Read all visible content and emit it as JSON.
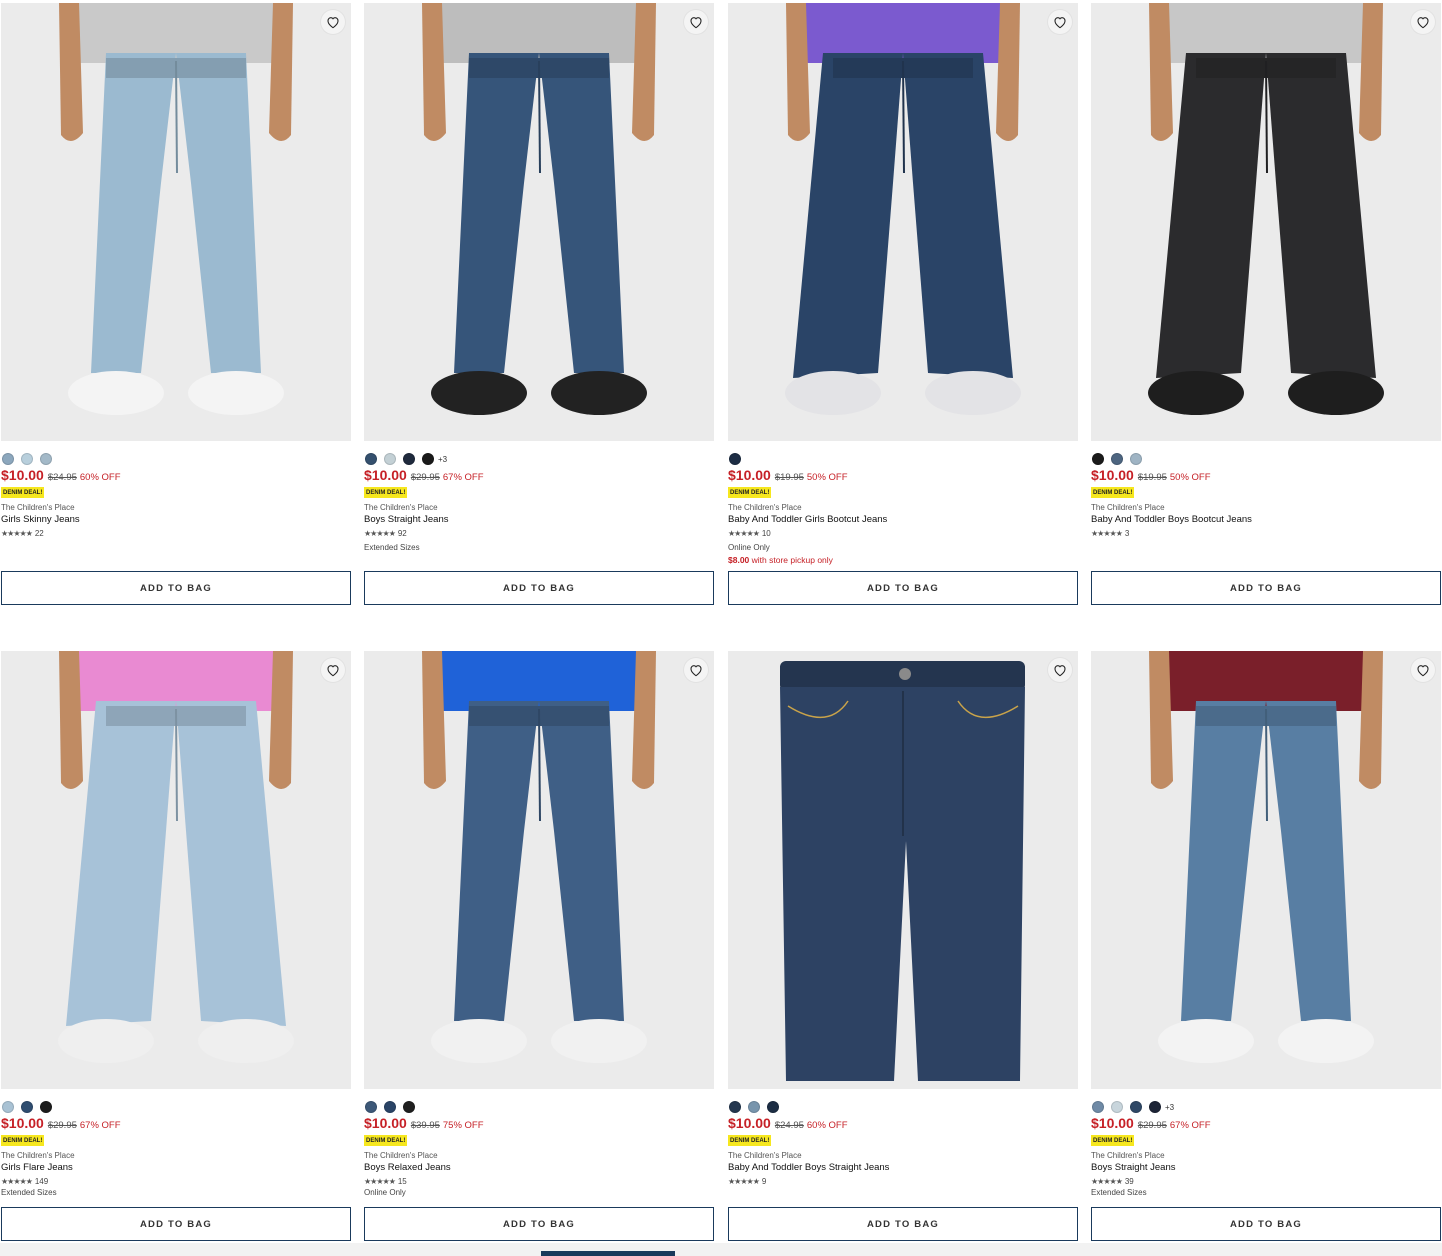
{
  "wishlist_icon": "heart-outline-icon",
  "add_to_bag_label": "ADD TO BAG",
  "colors": {
    "sale_red": "#c62127",
    "badge_yellow": "#f6e71e",
    "button_border": "#1a3a5c"
  },
  "products": [
    {
      "swatches": [
        "#8ca7bd",
        "#b8cfdc",
        "#a3b9c8"
      ],
      "more": "",
      "price": "$10.00",
      "was": "$24.95",
      "off": "60% OFF",
      "badge": "DENIM DEAL!",
      "brand": "The Children's Place",
      "name": "Girls Skinny Jeans",
      "stars": "★★★★★",
      "reviews": "22",
      "extra": "",
      "pickup_price": "",
      "pickup_text": "",
      "jean_color": "#9bbad0",
      "shirt_color": "#c9c9c9",
      "shoe_color": "#f4f4f4"
    },
    {
      "swatches": [
        "#34506e",
        "#c3d0d5",
        "#1f2a3d",
        "#1a1a1a"
      ],
      "more": "+3",
      "price": "$10.00",
      "was": "$29.95",
      "off": "67% OFF",
      "badge": "DENIM DEAL!",
      "brand": "The Children's Place",
      "name": "Boys Straight Jeans",
      "stars": "★★★★★",
      "reviews": "92",
      "extra": "Extended Sizes",
      "pickup_price": "",
      "pickup_text": "",
      "jean_color": "#36557a",
      "shirt_color": "#bdbdbd",
      "shoe_color": "#222222"
    },
    {
      "swatches": [
        "#1d2d44"
      ],
      "more": "",
      "price": "$10.00",
      "was": "$19.95",
      "off": "50% OFF",
      "badge": "DENIM DEAL!",
      "brand": "The Children's Place",
      "name": "Baby And Toddler Girls Bootcut Jeans",
      "stars": "★★★★★",
      "reviews": "10",
      "extra": "Online Only",
      "pickup_price": "$8.00",
      "pickup_text": "with store pickup only",
      "jean_color": "#2a4467",
      "shirt_color": "#7b5acf",
      "shoe_color": "#e3e3e6"
    },
    {
      "swatches": [
        "#1b1b1b",
        "#4d6580",
        "#9fb4c4"
      ],
      "more": "",
      "price": "$10.00",
      "was": "$19.95",
      "off": "50% OFF",
      "badge": "DENIM DEAL!",
      "brand": "The Children's Place",
      "name": "Baby And Toddler Boys Bootcut Jeans",
      "stars": "★★★★★",
      "reviews": "3",
      "extra": "",
      "pickup_price": "",
      "pickup_text": "",
      "jean_color": "#2b2b2d",
      "shirt_color": "#c7c7c7",
      "shoe_color": "#1e1e1e"
    },
    {
      "swatches": [
        "#a9c2d4",
        "#2f4d70",
        "#1c1c1c"
      ],
      "more": "",
      "price": "$10.00",
      "was": "$29.95",
      "off": "67% OFF",
      "badge": "DENIM DEAL!",
      "brand": "The Children's Place",
      "name": "Girls Flare Jeans",
      "stars": "★★★★★",
      "reviews": "149",
      "extra": "Extended Sizes",
      "pickup_price": "",
      "pickup_text": "",
      "jean_color": "#a7c2d8",
      "shirt_color": "#e98ad2",
      "shoe_color": "#efefef"
    },
    {
      "swatches": [
        "#3d5878",
        "#2a4466",
        "#1f1f1f"
      ],
      "more": "",
      "price": "$10.00",
      "was": "$39.95",
      "off": "75% OFF",
      "badge": "DENIM DEAL!",
      "brand": "The Children's Place",
      "name": "Boys Relaxed Jeans",
      "stars": "★★★★★",
      "reviews": "15",
      "extra": "Online Only",
      "pickup_price": "",
      "pickup_text": "",
      "jean_color": "#3f5f86",
      "shirt_color": "#1f62d8",
      "shoe_color": "#f1f1f1"
    },
    {
      "swatches": [
        "#24374f",
        "#7895ad",
        "#1c2d44"
      ],
      "more": "",
      "price": "$10.00",
      "was": "$24.95",
      "off": "60% OFF",
      "badge": "DENIM DEAL!",
      "brand": "The Children's Place",
      "name": "Baby And Toddler Boys Straight Jeans",
      "stars": "★★★★★",
      "reviews": "9",
      "extra": "",
      "pickup_price": "",
      "pickup_text": "",
      "jean_color": "#2d4263",
      "shirt_color": "",
      "shoe_color": ""
    },
    {
      "swatches": [
        "#6f8aa6",
        "#c8d5dc",
        "#2f4866",
        "#1d2436"
      ],
      "more": "+3",
      "price": "$10.00",
      "was": "$29.95",
      "off": "67% OFF",
      "badge": "DENIM DEAL!",
      "brand": "The Children's Place",
      "name": "Boys Straight Jeans",
      "stars": "★★★★★",
      "reviews": "39",
      "extra": "Extended Sizes",
      "pickup_price": "",
      "pickup_text": "",
      "jean_color": "#587ea3",
      "shirt_color": "#7a1f2a",
      "shoe_color": "#f3f3f3"
    }
  ]
}
